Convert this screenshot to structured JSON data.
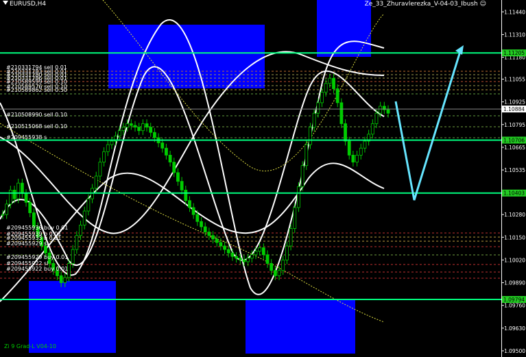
{
  "window": {
    "symbol": "EURUSD,H4",
    "expert": "Ze_33_Zhuravlerezka_V-04-03_Ibush",
    "indicator": "Zi 9 Grad-L V04-10"
  },
  "colors": {
    "background": "#000000",
    "candles": "#00cc00",
    "level_lines": "#00ff7f",
    "price_badge": "#22cc22",
    "current_badge": "#ffffff",
    "zones": "#0000ff",
    "forecast_arrow": "#66e5ff",
    "envelope": "#ffffff",
    "ma": "#e0e040"
  },
  "chart_data": {
    "type": "candlestick",
    "y_axis": {
      "range": [
        1.095,
        1.115
      ],
      "ticks": [
        "1.11440",
        "1.11310",
        "1.11180",
        "1.11055",
        "1.10925",
        "1.10795",
        "1.10665",
        "1.10535",
        "1.10405",
        "1.10280",
        "1.10150",
        "1.10020",
        "1.09890",
        "1.09760",
        "1.09630",
        "1.09500"
      ]
    },
    "levels": [
      {
        "price": "1.11205",
        "kind": "horizontal"
      },
      {
        "price": "1.10706",
        "kind": "horizontal"
      },
      {
        "price": "1.10403",
        "kind": "horizontal"
      },
      {
        "price": "1.09794",
        "kind": "horizontal"
      }
    ],
    "current_price": "1.10884",
    "close_series": [
      1.1028,
      1.1034,
      1.1042,
      1.1037,
      1.1046,
      1.104,
      1.1035,
      1.1029,
      1.1021,
      1.1015,
      1.101,
      1.1006,
      1.1,
      1.0996,
      1.0993,
      1.0989,
      1.0992,
      1.1,
      1.1008,
      1.1016,
      1.1022,
      1.103,
      1.1037,
      1.1043,
      1.105,
      1.1058,
      1.1064,
      1.1068,
      1.107,
      1.1073,
      1.1076,
      1.1078,
      1.108,
      1.1079,
      1.1078,
      1.1076,
      1.108,
      1.1078,
      1.1075,
      1.1072,
      1.1069,
      1.1066,
      1.1062,
      1.1058,
      1.1052,
      1.1047,
      1.1042,
      1.1036,
      1.1032,
      1.1028,
      1.1024,
      1.1021,
      1.1018,
      1.1016,
      1.1014,
      1.1012,
      1.101,
      1.1008,
      1.1006,
      1.1004,
      1.1003,
      1.1002,
      1.1001,
      1.1003,
      1.1005,
      1.1007,
      1.1009,
      1.1005,
      1.1,
      1.0996,
      1.0993,
      1.0996,
      1.1002,
      1.101,
      1.102,
      1.1032,
      1.1044,
      1.1056,
      1.1068,
      1.1078,
      1.1086,
      1.1092,
      1.1098,
      1.1103,
      1.1106,
      1.11,
      1.1092,
      1.108,
      1.107,
      1.1062,
      1.1058,
      1.1062,
      1.1066,
      1.107,
      1.1074,
      1.108,
      1.1086,
      1.109,
      1.1088,
      1.1086
    ],
    "orders": [
      {
        "label": "#210331794 sell 0.01"
      },
      {
        "label": "#210331783 sell 0.01"
      },
      {
        "label": "#210331780 sell 0.01"
      },
      {
        "label": "#210331786 sell 0.01"
      },
      {
        "label": "#210589599 sell 0.10"
      },
      {
        "label": "#210589576 sell 0.10"
      },
      {
        "label": "#210589862 sell 0.50"
      },
      {
        "label": "#210508990 sell 0.10"
      },
      {
        "label": "#210515068 sell 0.10"
      },
      {
        "label": "#209455938 s"
      },
      {
        "label": "#209455936 buy 0.01"
      },
      {
        "label": "#209455939 b 0.01"
      },
      {
        "label": "#209455933 b 0.01"
      },
      {
        "label": "#209455929 sl"
      },
      {
        "label": "#209455929 buy 0.01"
      },
      {
        "label": "#209455922 sl"
      },
      {
        "label": "#209455922 buy 0.01"
      }
    ]
  }
}
